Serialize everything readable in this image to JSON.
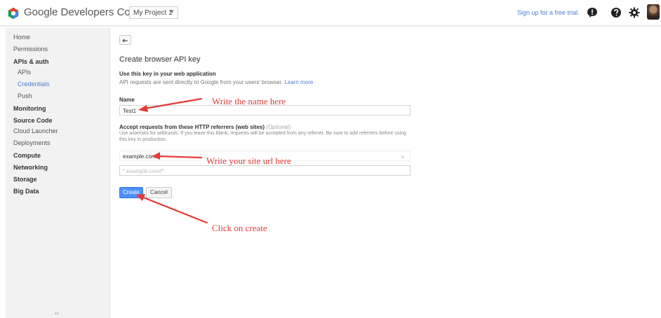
{
  "header": {
    "brand": "Google Developers Console",
    "project": "My Project 1",
    "trial_link": "Sign up for a free trial.",
    "icons": [
      "logo-icon",
      "feedback-icon",
      "help-icon",
      "settings-icon",
      "avatar"
    ]
  },
  "sidebar": {
    "items": [
      {
        "label": "Home"
      },
      {
        "label": "Permissions"
      },
      {
        "label": "APIs & auth"
      },
      {
        "label": "APIs"
      },
      {
        "label": "Credentials"
      },
      {
        "label": "Push"
      },
      {
        "label": "Monitoring"
      },
      {
        "label": "Source Code"
      },
      {
        "label": "Cloud Launcher"
      },
      {
        "label": "Deployments"
      },
      {
        "label": "Compute"
      },
      {
        "label": "Networking"
      },
      {
        "label": "Storage"
      },
      {
        "label": "Big Data"
      }
    ],
    "collapse": "‹‹"
  },
  "main": {
    "title": "Create browser API key",
    "section_head": "Use this key in your web application",
    "section_desc": "API requests are sent directly to Google from your users' browser.",
    "learn_more": "Learn more",
    "name_label": "Name",
    "name_value": "Test1",
    "referrer_label": "Accept requests from these HTTP referrers (web sites)",
    "referrer_optional": "(Optional)",
    "referrer_help": "Use asterisks for wildcards. If you leave this blank, requests will be accepted from any referrer. Be sure to add referrers before using this key in production.",
    "referrer_value": "example.com",
    "referrer_placeholder": "*.example.com/*",
    "clear": "×",
    "create": "Create",
    "cancel": "Cancel"
  },
  "annotations": {
    "name": "Write the name here",
    "url": "Write your site url here",
    "create": "Click on create"
  },
  "colors": {
    "accent": "#4a7ed7",
    "primary_button": "#4d90fe",
    "annotation": "#e53935"
  }
}
